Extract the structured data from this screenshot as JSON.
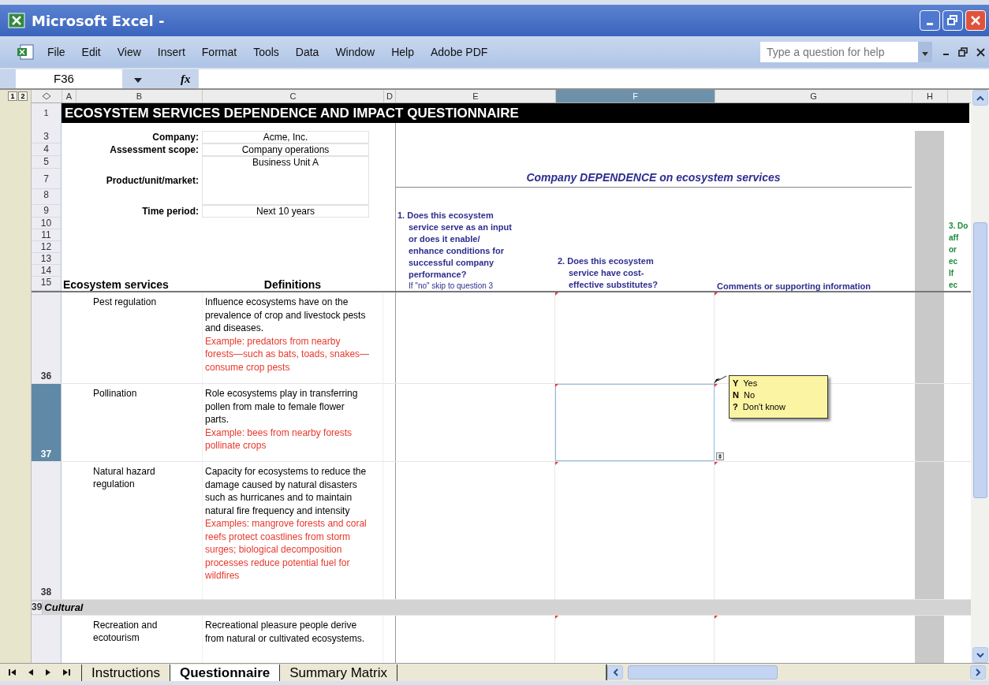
{
  "window": {
    "title": "Microsoft Excel -"
  },
  "menu": [
    "File",
    "Edit",
    "View",
    "Insert",
    "Format",
    "Tools",
    "Data",
    "Window",
    "Help",
    "Adobe PDF"
  ],
  "help": {
    "placeholder": "Type a question for help"
  },
  "formula_bar": {
    "name_box": "F36",
    "function_label": "fx"
  },
  "outline_levels": [
    "1",
    "2"
  ],
  "columns": [
    {
      "label": "A",
      "selected": false
    },
    {
      "label": "B",
      "selected": false
    },
    {
      "label": "C",
      "selected": false
    },
    {
      "label": "D",
      "selected": false
    },
    {
      "label": "E",
      "selected": false
    },
    {
      "label": "F",
      "selected": true
    },
    {
      "label": "G",
      "selected": false
    },
    {
      "label": "H",
      "selected": false
    }
  ],
  "title_row": {
    "number": "1",
    "text": "ECOSYSTEM SERVICES DEPENDENCE AND IMPACT QUESTIONNAIRE"
  },
  "header_rows": [
    "3",
    "4",
    "5",
    "7",
    "8",
    "9",
    "10",
    "11",
    "12",
    "13",
    "14",
    "15"
  ],
  "info": [
    {
      "label": "Company:",
      "value": "Acme, Inc."
    },
    {
      "label": "Assessment scope:",
      "value": "Company operations"
    },
    {
      "label": "Product/unit/market:",
      "value": "Business Unit A"
    },
    {
      "label": "Time period:",
      "value": "Next 10 years"
    }
  ],
  "section_heading": "Company DEPENDENCE on ecosystem services",
  "questions": [
    {
      "text": "1. Does this ecosystem service serve as an input or does it enable/ enhance conditions for successful company performance?",
      "note": "If \"no\" skip to question 3"
    },
    {
      "text": "2. Does this ecosystem service have cost-effective substitutes?"
    }
  ],
  "comments_heading": "Comments or supporting information",
  "column_headings": [
    "Ecosystem services",
    "Definitions"
  ],
  "next_question_lines": [
    "3. Do",
    "aff",
    "or",
    "ec",
    "If",
    "ec"
  ],
  "rows": [
    {
      "number": "36",
      "kind": "service",
      "selected": false,
      "service": "Pest regulation",
      "definition": "Influence ecosystems have on the prevalence of crop and livestock pests and diseases.",
      "example": "Example: predators from nearby forests—such as bats, toads, snakes—consume crop pests"
    },
    {
      "number": "37",
      "kind": "service",
      "selected": true,
      "service": "Pollination",
      "definition": "Role ecosystems play in transferring pollen from male to female flower parts.",
      "example": "Example: bees from nearby forests pollinate crops"
    },
    {
      "number": "38",
      "kind": "service",
      "selected": false,
      "service": "Natural hazard regulation",
      "definition": "Capacity for ecosystems to reduce the damage caused by natural disasters such as hurricanes and to maintain natural fire frequency and intensity",
      "example": "Examples: mangrove forests and coral reefs protect coastlines from storm surges; biological decomposition processes reduce potential fuel for wildfires"
    },
    {
      "number": "39",
      "kind": "group",
      "selected": false,
      "label": "Cultural"
    },
    {
      "kind": "service",
      "selected": false,
      "service": "Recreation and ecotourism",
      "definition": "Recreational pleasure people derive from natural or cultivated ecosystems."
    }
  ],
  "tooltip": {
    "lines": [
      "**Y**  Yes",
      "**N**  No",
      "**?**  Don't know"
    ]
  },
  "sheet_tabs": [
    {
      "label": "Instructions",
      "selected": false
    },
    {
      "label": "Questionnaire",
      "selected": true
    },
    {
      "label": "Summary Matrix",
      "selected": false
    }
  ]
}
